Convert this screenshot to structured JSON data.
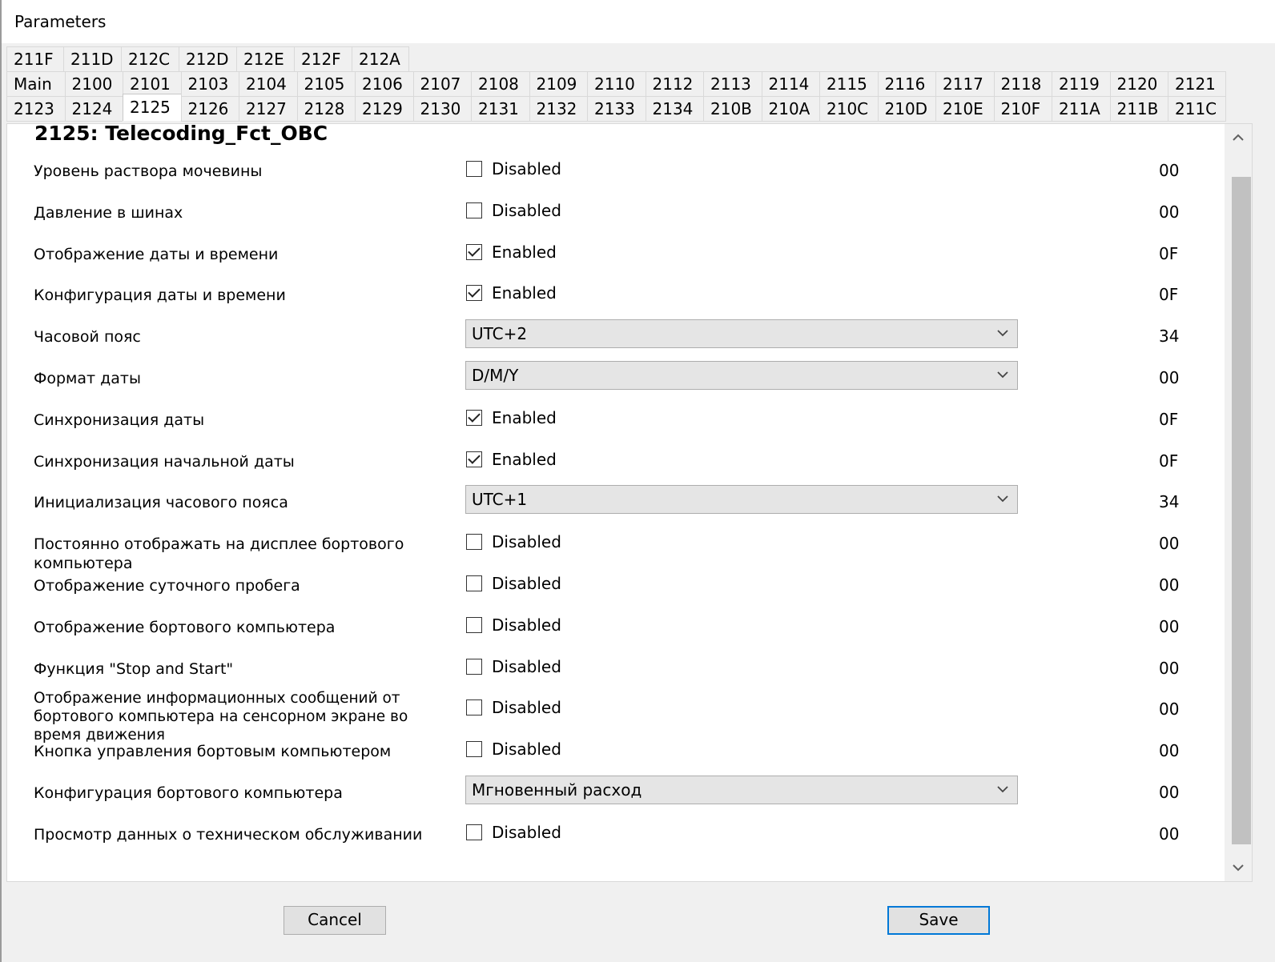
{
  "window": {
    "title": "Parameters"
  },
  "tabs": {
    "row1": [
      "211F",
      "211D",
      "212C",
      "212D",
      "212E",
      "212F",
      "212A"
    ],
    "row2": [
      "Main",
      "2100",
      "2101",
      "2103",
      "2104",
      "2105",
      "2106",
      "2107",
      "2108",
      "2109",
      "2110",
      "2112",
      "2113",
      "2114",
      "2115",
      "2116",
      "2117",
      "2118",
      "2119",
      "2120",
      "2121"
    ],
    "row3": [
      "2123",
      "2124",
      "2125",
      "2126",
      "2127",
      "2128",
      "2129",
      "2130",
      "2131",
      "2132",
      "2133",
      "2134",
      "210B",
      "210A",
      "210C",
      "210D",
      "210E",
      "210F",
      "211A",
      "211B",
      "211C"
    ],
    "active": "2125"
  },
  "section": {
    "title": "2125: Telecoding_Fct_OBC"
  },
  "params": [
    {
      "label": "Уровень раствора мочевины",
      "control": "checkbox",
      "checked": false,
      "state": "Disabled",
      "hex": "00"
    },
    {
      "label": "Давление в шинах",
      "control": "checkbox",
      "checked": false,
      "state": "Disabled",
      "hex": "00"
    },
    {
      "label": "Отображение даты и времени",
      "control": "checkbox",
      "checked": true,
      "state": "Enabled",
      "hex": "0F"
    },
    {
      "label": "Конфигурация даты и времени",
      "control": "checkbox",
      "checked": true,
      "state": "Enabled",
      "hex": "0F"
    },
    {
      "label": "Часовой пояс",
      "control": "combo",
      "value": "UTC+2",
      "hex": "34"
    },
    {
      "label": "Формат даты",
      "control": "combo",
      "value": "D/M/Y",
      "hex": "00"
    },
    {
      "label": "Синхронизация даты",
      "control": "checkbox",
      "checked": true,
      "state": "Enabled",
      "hex": "0F"
    },
    {
      "label": "Синхронизация начальной даты",
      "control": "checkbox",
      "checked": true,
      "state": "Enabled",
      "hex": "0F"
    },
    {
      "label": "Инициализация часового пояса",
      "control": "combo",
      "value": "UTC+1",
      "hex": "34"
    },
    {
      "label": "Постоянно отображать на дисплее бортового компьютера",
      "control": "checkbox",
      "checked": false,
      "state": "Disabled",
      "hex": "00"
    },
    {
      "label": "Отображение суточного пробега",
      "control": "checkbox",
      "checked": false,
      "state": "Disabled",
      "hex": "00"
    },
    {
      "label": "Отображение бортового компьютера",
      "control": "checkbox",
      "checked": false,
      "state": "Disabled",
      "hex": "00"
    },
    {
      "label": "Функция \"Stop and Start\"",
      "control": "checkbox",
      "checked": false,
      "state": "Disabled",
      "hex": "00"
    },
    {
      "label": "Отображение информационных сообщений от бортового компьютера на сенсорном экране во время движения",
      "control": "checkbox",
      "checked": false,
      "state": "Disabled",
      "hex": "00",
      "multiline": true
    },
    {
      "label": "Кнопка управления бортовым компьютером",
      "control": "checkbox",
      "checked": false,
      "state": "Disabled",
      "hex": "00"
    },
    {
      "label": "Конфигурация бортового компьютера",
      "control": "combo",
      "value": "Мгновенный расход",
      "hex": "00"
    },
    {
      "label": "Просмотр данных о техническом обслуживании",
      "control": "checkbox",
      "checked": false,
      "state": "Disabled",
      "hex": "00"
    }
  ],
  "buttons": {
    "cancel": "Cancel",
    "save": "Save"
  },
  "colors": {
    "focus_border": "#0078d7",
    "panel_bg": "#ffffff",
    "window_bg": "#f0f0f0"
  }
}
